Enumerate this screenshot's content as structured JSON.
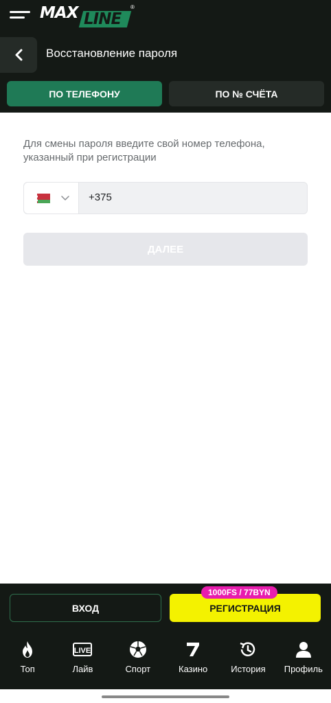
{
  "app": {
    "logo": {
      "part1": "MAX",
      "part2": "LINE",
      "reg_mark": "®"
    }
  },
  "header": {
    "title": "Восстановление пароля",
    "tabs": [
      {
        "label": "ПО ТЕЛЕФОНУ",
        "active": true
      },
      {
        "label": "ПО № СЧЁТА",
        "active": false
      }
    ]
  },
  "form": {
    "hint": "Для смены пароля введите свой номер телефона, указанный при регистрации",
    "country_flag": "belarus-flag",
    "phone_value": "+375",
    "next_label": "ДАЛЕЕ"
  },
  "auth": {
    "login_label": "ВХОД",
    "register_label": "РЕГИСТРАЦИЯ",
    "promo_badge": "1000FS / 77BYN"
  },
  "nav": {
    "items": [
      {
        "label": "Топ",
        "icon": "fire-icon"
      },
      {
        "label": "Лайв",
        "icon": "live-icon"
      },
      {
        "label": "Спорт",
        "icon": "soccer-ball-icon"
      },
      {
        "label": "Казино",
        "icon": "seven-icon"
      },
      {
        "label": "История",
        "icon": "history-icon"
      },
      {
        "label": "Профиль",
        "icon": "user-icon"
      }
    ]
  },
  "colors": {
    "dark_bg": "#141915",
    "accent_green": "#1f7a56",
    "register_yellow": "#f4f200",
    "promo_pink": "#e81cae",
    "disabled_btn": "#e6e7eb"
  }
}
